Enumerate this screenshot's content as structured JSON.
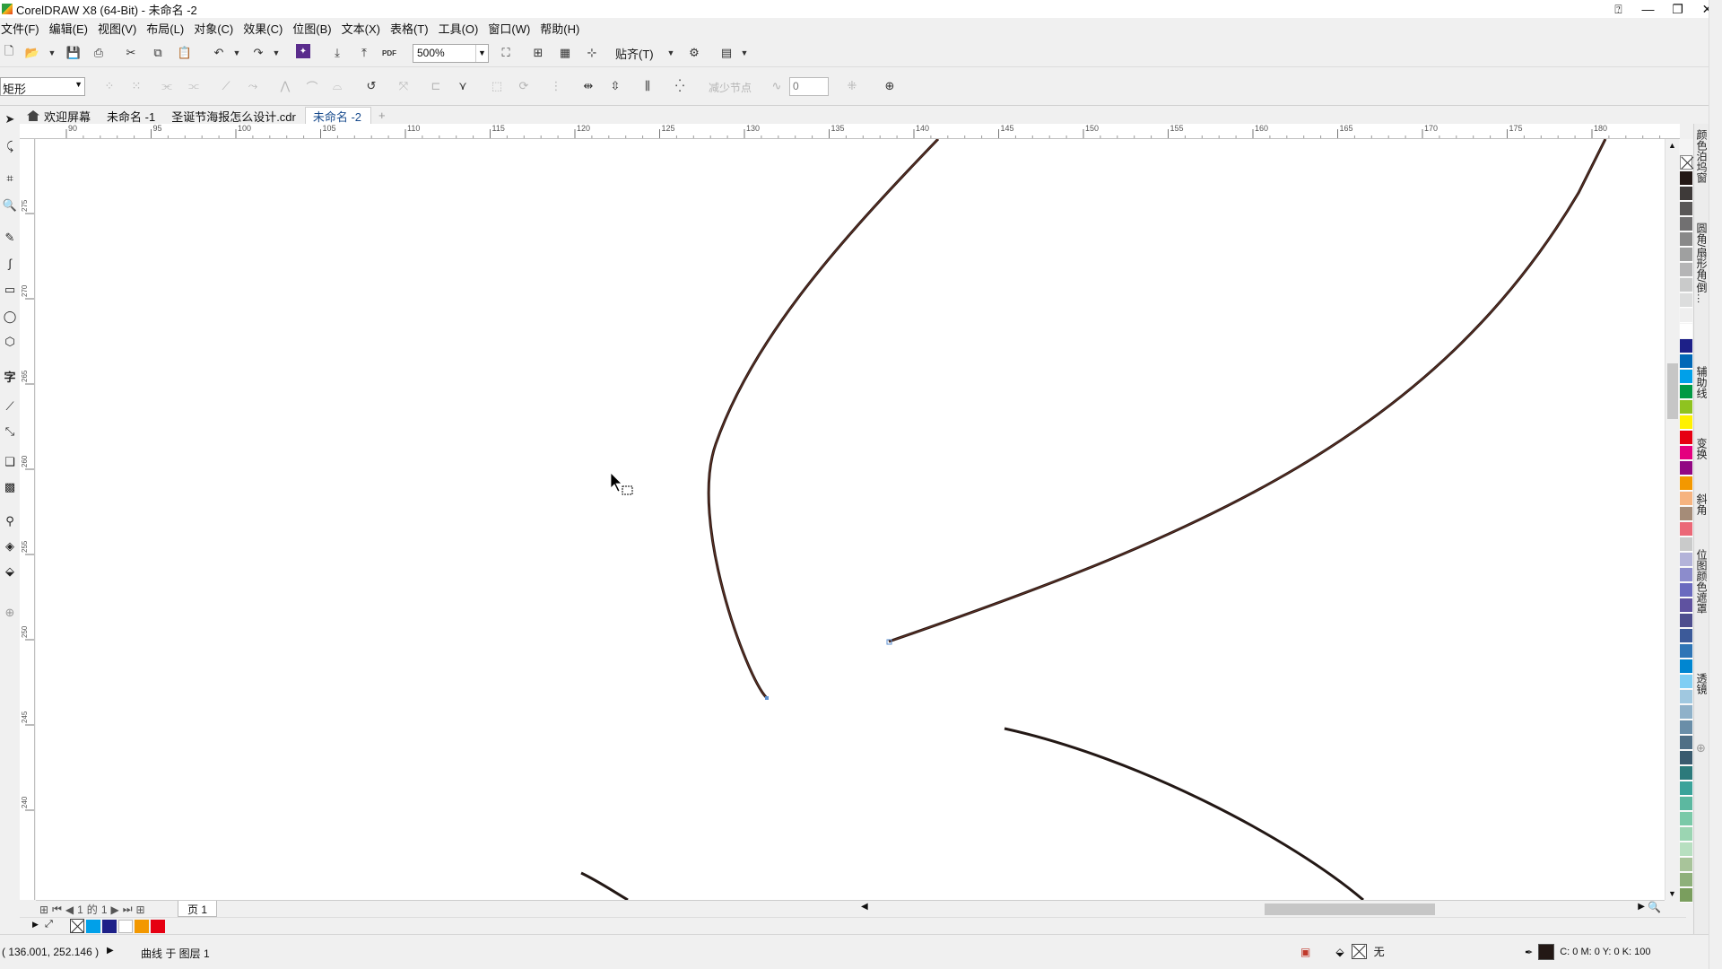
{
  "window": {
    "title": "CorelDRAW X8 (64-Bit) - 未命名 -2",
    "controls": {
      "help": "⍰",
      "minimize": "—",
      "restore": "❐",
      "close": "✕"
    }
  },
  "menu": [
    "文件(F)",
    "编辑(E)",
    "视图(V)",
    "布局(L)",
    "对象(C)",
    "效果(C)",
    "位图(B)",
    "文本(X)",
    "表格(T)",
    "工具(O)",
    "窗口(W)",
    "帮助(H)"
  ],
  "toolbar": {
    "zoom_value": "500%",
    "snap_label": "贴齐(T)",
    "pdf_label": "PDF"
  },
  "property_bar": {
    "shape_type": "矩形",
    "reduce_nodes_label": "减少节点",
    "smoothness_value": "0"
  },
  "tabs": [
    {
      "label": "欢迎屏幕",
      "icon": "home-icon",
      "active": false
    },
    {
      "label": "未命名 -1",
      "active": false
    },
    {
      "label": "圣诞节海报怎么设计.cdr",
      "active": false
    },
    {
      "label": "未命名 -2",
      "active": true
    }
  ],
  "ruler": {
    "h_ticks": [
      "90",
      "95",
      "100",
      "105",
      "110",
      "115",
      "120",
      "125",
      "130",
      "135",
      "140",
      "145",
      "150",
      "155",
      "160",
      "165",
      "170",
      "175",
      "180"
    ],
    "v_ticks": [
      "275",
      "270",
      "265",
      "260",
      "255",
      "250",
      "245",
      "240"
    ]
  },
  "dockers": [
    "颜色泊坞窗",
    "圆角/扇形角/倒…",
    "辅助线",
    "变换",
    "斜角",
    "位图颜色遮罩",
    "透镜"
  ],
  "palette_colors": [
    "#231815",
    "#3e3a39",
    "#595757",
    "#717071",
    "#898989",
    "#9fa0a0",
    "#b5b5b6",
    "#c9caca",
    "#dcdddd",
    "#efefef",
    "#ffffff",
    "#1d2088",
    "#0068b7",
    "#00a0e9",
    "#009944",
    "#8fc31f",
    "#fff100",
    "#e60012",
    "#e4007f",
    "#920783",
    "#f39800",
    "#f6b37f",
    "#a58c78",
    "#eb6877",
    "#c9caca",
    "#b3b3d9",
    "#8c8ccc",
    "#6a6abf",
    "#5f52a0",
    "#4e4e8e",
    "#3c5a99",
    "#2e75b6",
    "#0086d1",
    "#7ecef4",
    "#a0c8e0",
    "#8fb1c9",
    "#6a8ea8",
    "#4f6f86",
    "#3a5a6e",
    "#2c7a7b",
    "#3ba39a",
    "#5cb8a0",
    "#7ac9a8",
    "#9bd5b2",
    "#b7dfc0",
    "#a8c49a",
    "#8eb07a",
    "#7a9e5e"
  ],
  "document_palette": [
    "#00a0e9",
    "#1d2088",
    "#ffffff",
    "#f39800",
    "#e60012"
  ],
  "pages": {
    "current": "1",
    "of_label": "的",
    "total": "1",
    "page_tab": "页 1"
  },
  "status": {
    "coords": "( 136.001, 252.146 )",
    "object_info": "曲线 于 图层 1",
    "fill_label": "无",
    "outline_info": "C: 0 M: 0 Y: 0 K: 100"
  }
}
